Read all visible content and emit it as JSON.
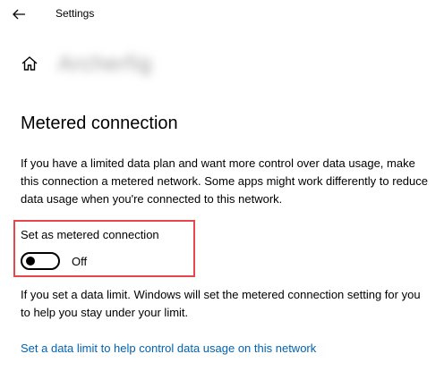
{
  "window": {
    "title": "Settings"
  },
  "header": {
    "network_name": "Archerfig"
  },
  "section": {
    "title": "Metered connection",
    "description": "If you have a limited data plan and want more control over data usage, make this connection a metered network. Some apps might work differently to reduce data usage when you're connected to this network."
  },
  "toggle": {
    "label": "Set as metered connection",
    "state_text": "Off",
    "on": false
  },
  "footer": {
    "note": "If you set a data limit. Windows will set the metered connection setting for you to help you stay under your limit.",
    "link": "Set a data limit to help control data usage on this network"
  },
  "colors": {
    "accent_link": "#0063b1",
    "highlight": "#e8464a"
  },
  "icons": {
    "back": "back-arrow-icon",
    "home": "home-icon"
  }
}
